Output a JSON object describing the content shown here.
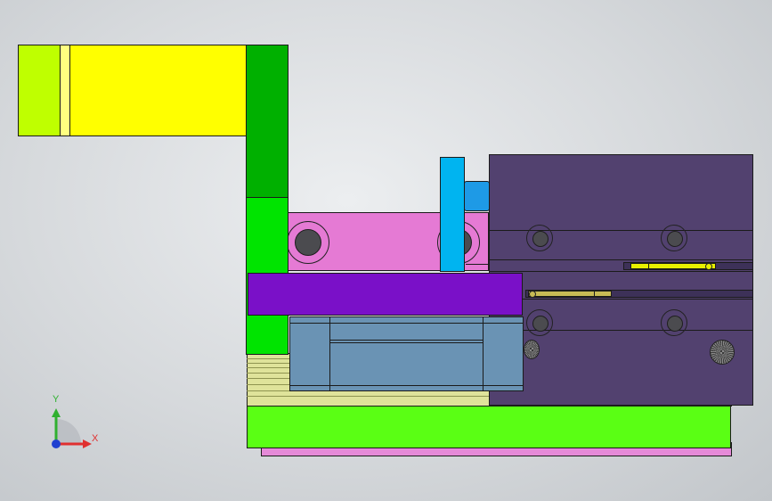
{
  "viewport": {
    "background_center": "#eceef0",
    "background_edge": "#c2c6ca",
    "outline_color": "#1b1b1b"
  },
  "parts": {
    "top_bracket": {
      "color": "#ffff00",
      "side_color": "#bfff00",
      "strip_color": "#ffff80"
    },
    "vertical_plate_upper": {
      "color": "#00b000"
    },
    "vertical_plate_lower": {
      "color": "#00e400"
    },
    "pink_block": {
      "color": "#e57ad4"
    },
    "blue_post": {
      "color": "#00b4f0"
    },
    "blue_stub": {
      "color": "#1e9ae6"
    },
    "cylinder_body": {
      "color": "#52416f"
    },
    "violet_bar": {
      "color": "#7a10c8"
    },
    "slide_block": {
      "color": "#6a93b4"
    },
    "rail_stack": {
      "color": "#dfe39a",
      "line_color": "#8f9450"
    },
    "base_plate": {
      "color": "#5aff14"
    },
    "bottom_shadow_plate": {
      "color": "#e58ad8"
    },
    "yellow_rod": {
      "color": "#e8f000"
    },
    "tan_rod": {
      "color": "#c8bb55"
    }
  },
  "triad": {
    "x_label": "X",
    "y_label": "Y",
    "x_color": "#e03030",
    "y_color": "#30b030",
    "z_color": "#2040d0"
  }
}
